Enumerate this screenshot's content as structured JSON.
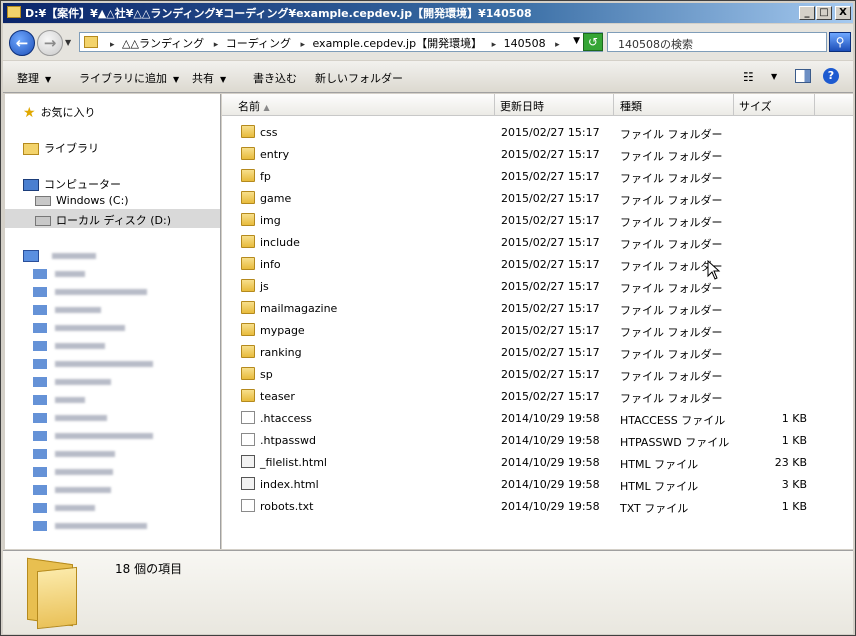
{
  "window": {
    "title": "D:¥【案件】¥▲△社¥△△ランディング¥コーディング¥example.cepdev.jp【開発環境】¥140508",
    "min": "_",
    "max": "□",
    "close": "X"
  },
  "address": {
    "crumbs": [
      "△△ランディング",
      "コーディング",
      "example.cepdev.jp【開発環境】",
      "140508"
    ],
    "search_placeholder": "140508の検索"
  },
  "toolbar": {
    "organize": "整理",
    "add_to_library": "ライブラリに追加",
    "share": "共有",
    "burn": "書き込む",
    "new_folder": "新しいフォルダー"
  },
  "nav": {
    "favorites": "お気に入り",
    "libraries": "ライブラリ",
    "computer": "コンピューター",
    "drive_c": "Windows (C:)",
    "drive_d": "ローカル ディスク (D:)"
  },
  "columns": {
    "name": "名前",
    "date": "更新日時",
    "type": "種類",
    "size": "サイズ"
  },
  "files": [
    {
      "name": "css",
      "date": "2015/02/27 15:17",
      "type": "ファイル フォルダー",
      "size": "",
      "icon": "folder"
    },
    {
      "name": "entry",
      "date": "2015/02/27 15:17",
      "type": "ファイル フォルダー",
      "size": "",
      "icon": "folder"
    },
    {
      "name": "fp",
      "date": "2015/02/27 15:17",
      "type": "ファイル フォルダー",
      "size": "",
      "icon": "folder"
    },
    {
      "name": "game",
      "date": "2015/02/27 15:17",
      "type": "ファイル フォルダー",
      "size": "",
      "icon": "folder"
    },
    {
      "name": "img",
      "date": "2015/02/27 15:17",
      "type": "ファイル フォルダー",
      "size": "",
      "icon": "folder"
    },
    {
      "name": "include",
      "date": "2015/02/27 15:17",
      "type": "ファイル フォルダー",
      "size": "",
      "icon": "folder"
    },
    {
      "name": "info",
      "date": "2015/02/27 15:17",
      "type": "ファイル フォルダー",
      "size": "",
      "icon": "folder"
    },
    {
      "name": "js",
      "date": "2015/02/27 15:17",
      "type": "ファイル フォルダー",
      "size": "",
      "icon": "folder"
    },
    {
      "name": "mailmagazine",
      "date": "2015/02/27 15:17",
      "type": "ファイル フォルダー",
      "size": "",
      "icon": "folder"
    },
    {
      "name": "mypage",
      "date": "2015/02/27 15:17",
      "type": "ファイル フォルダー",
      "size": "",
      "icon": "folder"
    },
    {
      "name": "ranking",
      "date": "2015/02/27 15:17",
      "type": "ファイル フォルダー",
      "size": "",
      "icon": "folder"
    },
    {
      "name": "sp",
      "date": "2015/02/27 15:17",
      "type": "ファイル フォルダー",
      "size": "",
      "icon": "folder"
    },
    {
      "name": "teaser",
      "date": "2015/02/27 15:17",
      "type": "ファイル フォルダー",
      "size": "",
      "icon": "folder"
    },
    {
      "name": ".htaccess",
      "date": "2014/10/29 19:58",
      "type": "HTACCESS ファイル",
      "size": "1 KB",
      "icon": "file"
    },
    {
      "name": ".htpasswd",
      "date": "2014/10/29 19:58",
      "type": "HTPASSWD ファイル",
      "size": "1 KB",
      "icon": "file"
    },
    {
      "name": "_filelist.html",
      "date": "2014/10/29 19:58",
      "type": "HTML ファイル",
      "size": "23 KB",
      "icon": "html"
    },
    {
      "name": "index.html",
      "date": "2014/10/29 19:58",
      "type": "HTML ファイル",
      "size": "3 KB",
      "icon": "html"
    },
    {
      "name": "robots.txt",
      "date": "2014/10/29 19:58",
      "type": "TXT ファイル",
      "size": "1 KB",
      "icon": "txt"
    }
  ],
  "status": {
    "item_count": "18 個の項目"
  }
}
